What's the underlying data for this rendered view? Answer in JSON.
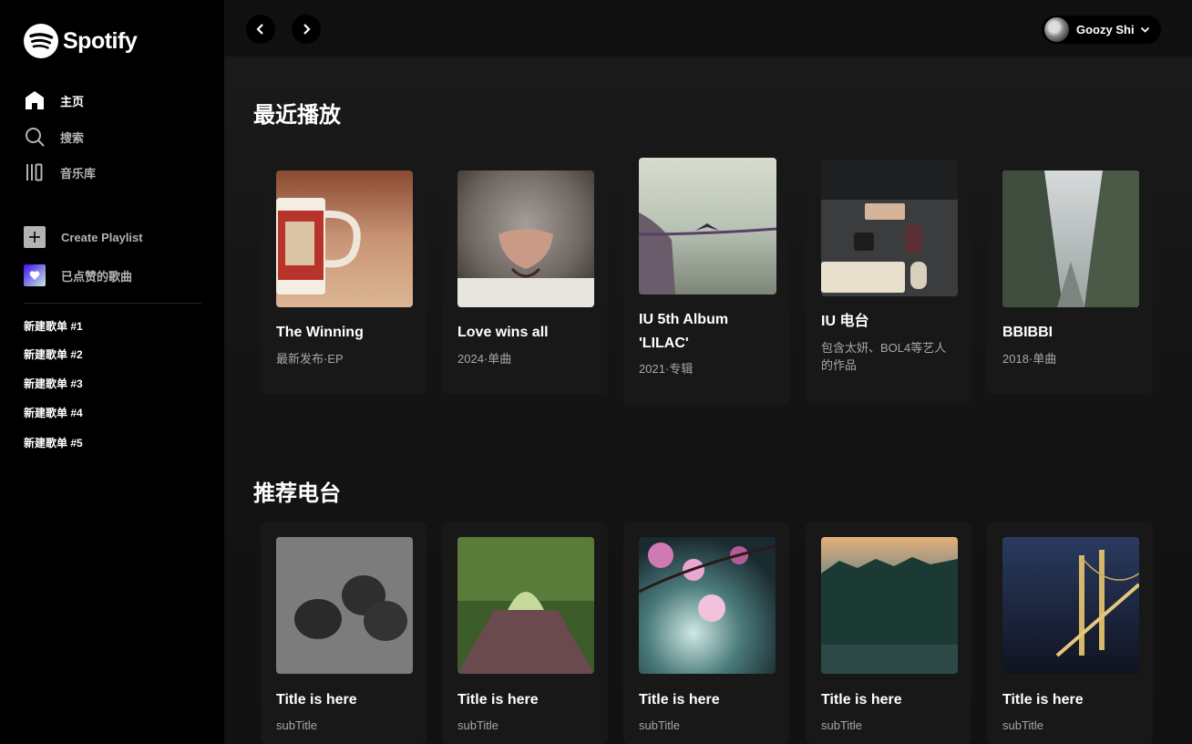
{
  "app": {
    "brand": "Spotify"
  },
  "sidebar": {
    "nav": [
      {
        "label": "主页",
        "icon": "home-icon",
        "active": true
      },
      {
        "label": "搜索",
        "icon": "search-icon",
        "active": false
      },
      {
        "label": "音乐库",
        "icon": "library-icon",
        "active": false
      }
    ],
    "create_playlist": "Create Playlist",
    "liked_songs": "已点赞的歌曲",
    "playlists": [
      "新建歌单 #1",
      "新建歌单 #2",
      "新建歌单 #3",
      "新建歌单 #4",
      "新建歌单 #5"
    ]
  },
  "header": {
    "user_name": "Goozy Shi"
  },
  "sections": {
    "recent": {
      "title": "最近播放",
      "items": [
        {
          "title": "The Winning",
          "subtitle": "最新发布·EP",
          "image": "red-mug"
        },
        {
          "title": "Love wins all",
          "subtitle": "2024·单曲",
          "image": "cat-nose"
        },
        {
          "title": "IU 5th Album 'LILAC'",
          "subtitle": "2021·专辑",
          "image": "seascape-bird"
        },
        {
          "title": "IU 电台",
          "subtitle": "包含太妍、BOL4等艺人的作品",
          "image": "desk-setup"
        },
        {
          "title": "BBIBBI",
          "subtitle": "2018·单曲",
          "image": "foggy-tree-road"
        }
      ]
    },
    "radio": {
      "title": "推荐电台",
      "items": [
        {
          "title": "Title is here",
          "subtitle": "subTitle",
          "image": "pinecones"
        },
        {
          "title": "Title is here",
          "subtitle": "subTitle",
          "image": "forest-path"
        },
        {
          "title": "Title is here",
          "subtitle": "subTitle",
          "image": "pink-blossoms"
        },
        {
          "title": "Title is here",
          "subtitle": "subTitle",
          "image": "forest-sunset"
        },
        {
          "title": "Title is here",
          "subtitle": "subTitle",
          "image": "bridge-night"
        }
      ]
    }
  },
  "colors": {
    "background": "#000000",
    "main": "#121212",
    "card": "#181818",
    "text_secondary": "#a7a7a7",
    "brand_green": "#1ed760"
  }
}
